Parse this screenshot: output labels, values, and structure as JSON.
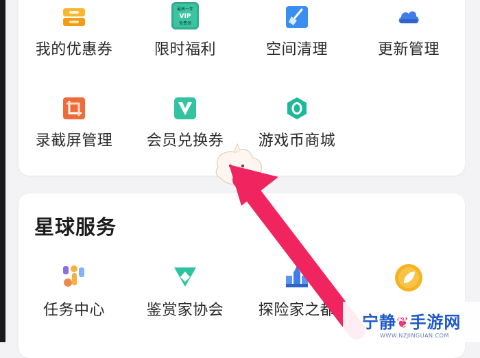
{
  "top_grid": {
    "row1": [
      {
        "label": "我的优惠券",
        "icon": "coupon-icon",
        "color": "#f5a623"
      },
      {
        "label": "限时福利",
        "icon": "vip-coupon-icon",
        "color": "#2fae8e",
        "badge_line1": "最高一年",
        "badge_line2": "VIP",
        "badge_line3": "免费领"
      },
      {
        "label": "空间清理",
        "icon": "broom-icon",
        "color": "#3a8ef0"
      },
      {
        "label": "更新管理",
        "icon": "cloud-icon",
        "color": "#3f7ee8"
      }
    ],
    "row2": [
      {
        "label": "录截屏管理",
        "icon": "screenshot-icon",
        "color": "#ef6b3a"
      },
      {
        "label": "会员兑换券",
        "icon": "vip-v-icon",
        "color": "#34c3a0"
      },
      {
        "label": "游戏币商城",
        "icon": "hexagon-coin-icon",
        "color": "#1fb79a"
      }
    ]
  },
  "planet_services": {
    "title": "星球服务",
    "items": [
      {
        "label": "任务中心",
        "icon": "task-people-icon"
      },
      {
        "label": "鉴赏家协会",
        "icon": "triangle-badge-icon"
      },
      {
        "label": "探险家之都",
        "icon": "castle-icon"
      },
      {
        "label": "",
        "icon": "leaf-coin-icon"
      }
    ]
  },
  "watermark": {
    "part1": "宁静",
    "part2": "手游网",
    "url": "WWW.NZJINGUAN.COM"
  },
  "colors": {
    "arrow": "#f0245f",
    "background": "#f3f3f5"
  }
}
